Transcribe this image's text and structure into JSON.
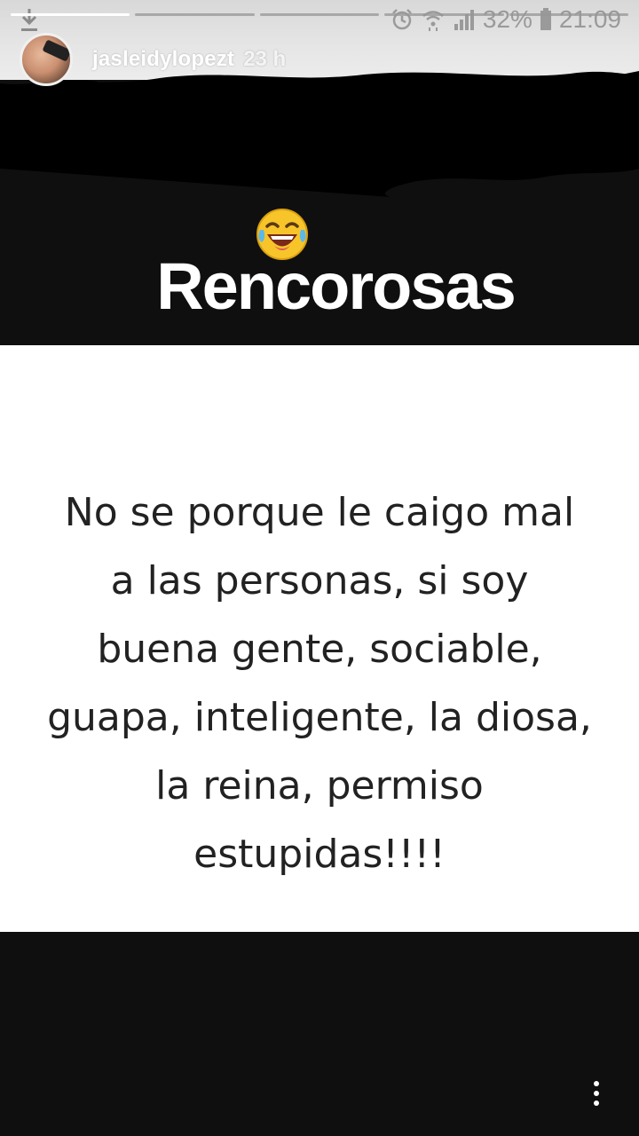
{
  "status_bar": {
    "battery_text": "32%",
    "time": "21:09",
    "icons": [
      "download-icon",
      "alarm-icon",
      "wifi-icon",
      "signal-icon",
      "battery-icon"
    ]
  },
  "story": {
    "progress": [
      1.0,
      0.0,
      0.0,
      0.0,
      0.0
    ],
    "user": {
      "username": "jasleidylopezt",
      "timestamp": "23 h"
    },
    "sticker": "laughing-tears-emoji",
    "heading": "Rencorosas",
    "shared_image_text": "No se porque le caigo mal\na las personas, si soy\nbuena gente, sociable,\nguapa, inteligente, la diosa,\nla reina, permiso\nestupidas!!!!",
    "menu_icon": "more-vertical-icon"
  },
  "colors": {
    "background": "#0f0f0f",
    "header_strip": "#e4e4e4",
    "card": "#ffffff",
    "quote_text": "#222222",
    "heading_text": "#ffffff"
  }
}
